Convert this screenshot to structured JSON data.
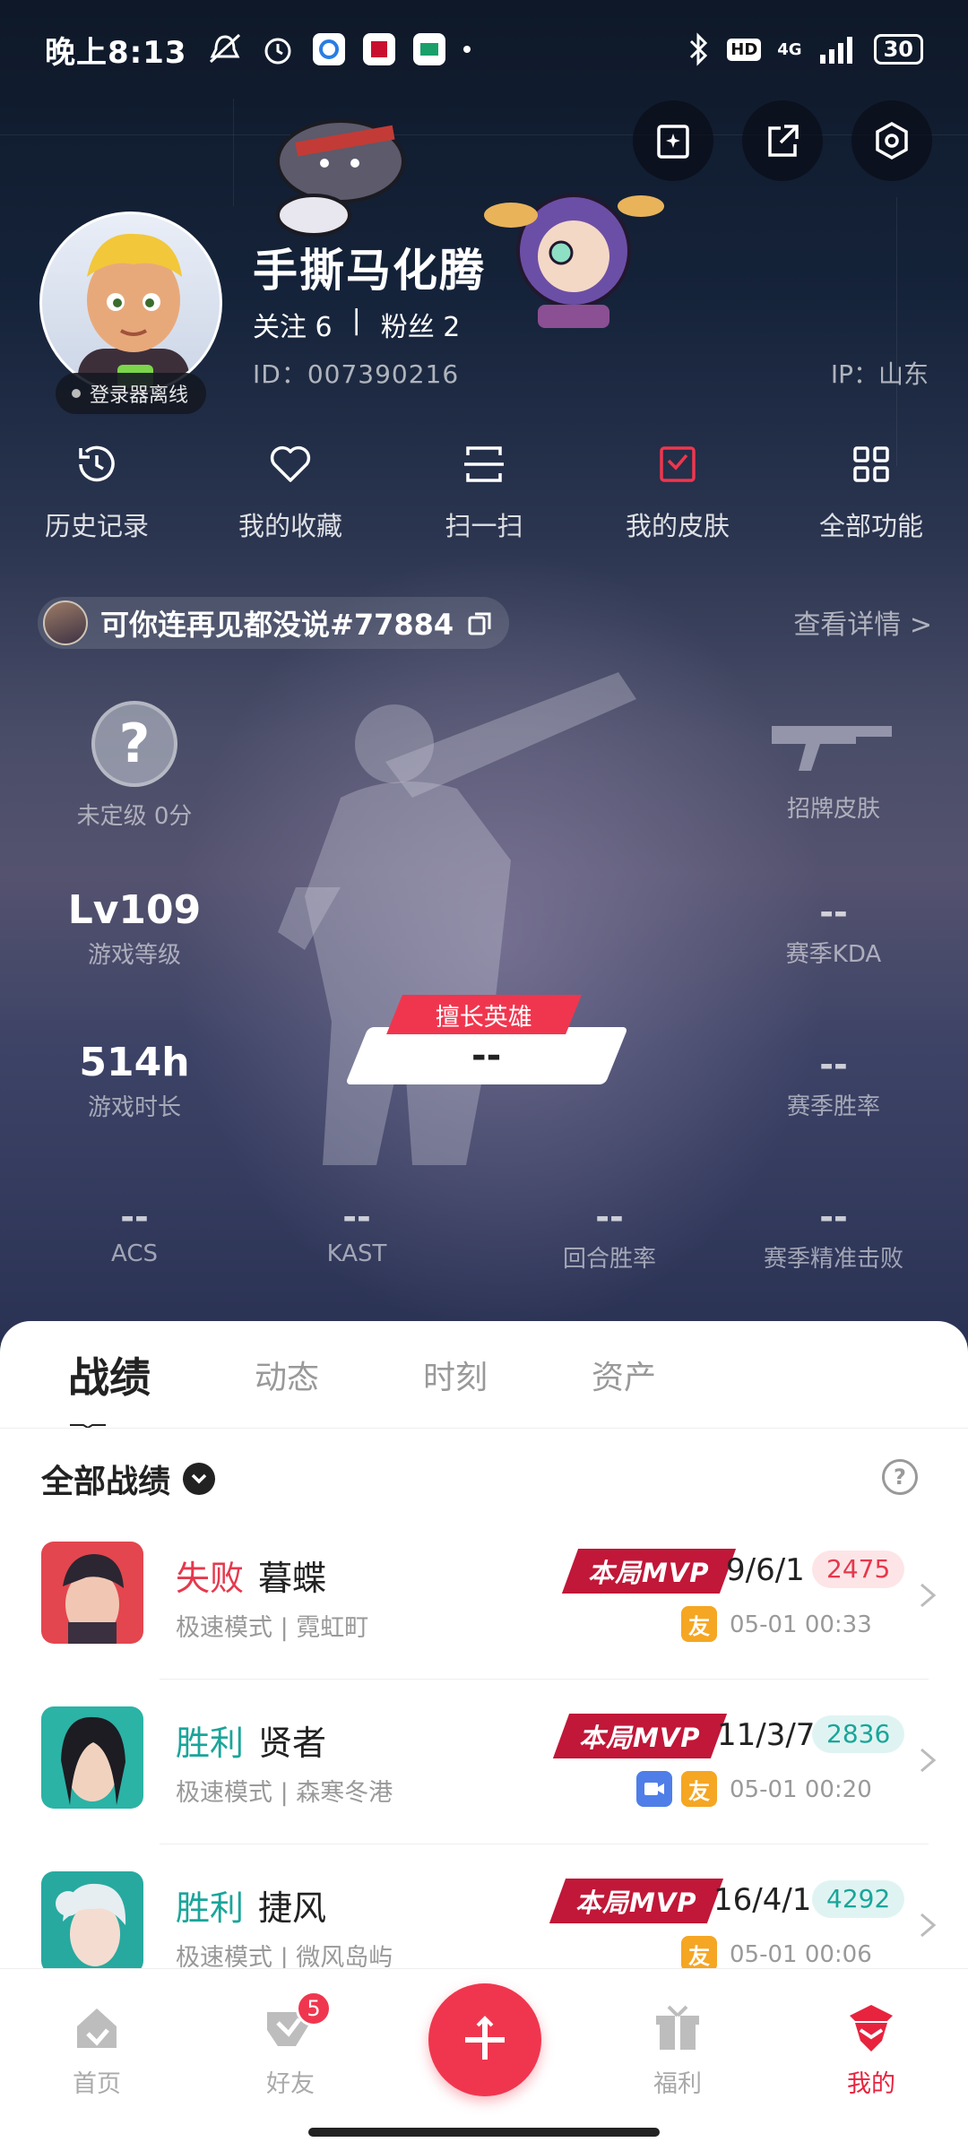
{
  "status_bar": {
    "time": "晚上8:13",
    "network": "4G",
    "battery": "30"
  },
  "profile": {
    "username": "手撕马化腾",
    "follow_label": "关注",
    "follow_count": "6",
    "separator": "|",
    "fans_label": "粉丝",
    "fans_count": "2",
    "id_text": "ID：007390216",
    "ip_text": "IP：山东",
    "offline_status": "登录器离线"
  },
  "quick_actions": [
    {
      "label": "历史记录",
      "icon": "history-icon"
    },
    {
      "label": "我的收藏",
      "icon": "heart-icon"
    },
    {
      "label": "扫一扫",
      "icon": "scan-icon"
    },
    {
      "label": "我的皮肤",
      "icon": "skin-icon"
    },
    {
      "label": "全部功能",
      "icon": "grid-icon"
    }
  ],
  "game_account": {
    "name": "可你连再见都没说#77884",
    "detail_link": "查看详情 >"
  },
  "stats": {
    "rank_icon_text": "?",
    "rank": "未定级 0分",
    "signature_skin": "招牌皮肤",
    "level_value": "Lv109",
    "level_label": "游戏等级",
    "kda_value": "--",
    "kda_label": "赛季KDA",
    "hours_value": "514h",
    "hours_label": "游戏时长",
    "winrate_value": "--",
    "winrate_label": "赛季胜率",
    "favorite_hero_tag": "擅长英雄",
    "favorite_hero_value": "--",
    "acs_value": "--",
    "acs_label": "ACS",
    "kast_value": "--",
    "kast_label": "KAST",
    "round_win_value": "--",
    "round_win_label": "回合胜率",
    "precise_kills_value": "--",
    "precise_kills_label": "赛季精准击败"
  },
  "tabs": [
    "战绩",
    "动态",
    "时刻",
    "资产"
  ],
  "records": {
    "title": "全部战绩",
    "help_icon_text": "?",
    "items": [
      {
        "result": "失败",
        "agent": "暮蝶",
        "mode": "极速模式 | 霓虹町",
        "mvp": "本局MVP",
        "kda": "9/6/1",
        "score": "2475",
        "friend": "友",
        "time": "05-01 00:33",
        "win": false
      },
      {
        "result": "胜利",
        "agent": "贤者",
        "mode": "极速模式 | 森寒冬港",
        "mvp": "本局MVP",
        "kda": "11/3/7",
        "score": "2836",
        "friend": "友",
        "time": "05-01 00:20",
        "win": true
      },
      {
        "result": "胜利",
        "agent": "捷风",
        "mode": "极速模式 | 微风岛屿",
        "mvp": "本局MVP",
        "kda": "16/4/1",
        "score": "4292",
        "friend": "友",
        "time": "05-01 00:06",
        "win": true
      }
    ]
  },
  "bottom_nav": {
    "home": "首页",
    "friends": "好友",
    "friends_badge": "5",
    "welfare": "福利",
    "mine": "我的"
  },
  "colors": {
    "accent": "#f0364e",
    "win": "#1aa59a",
    "loss": "#e6384c"
  }
}
